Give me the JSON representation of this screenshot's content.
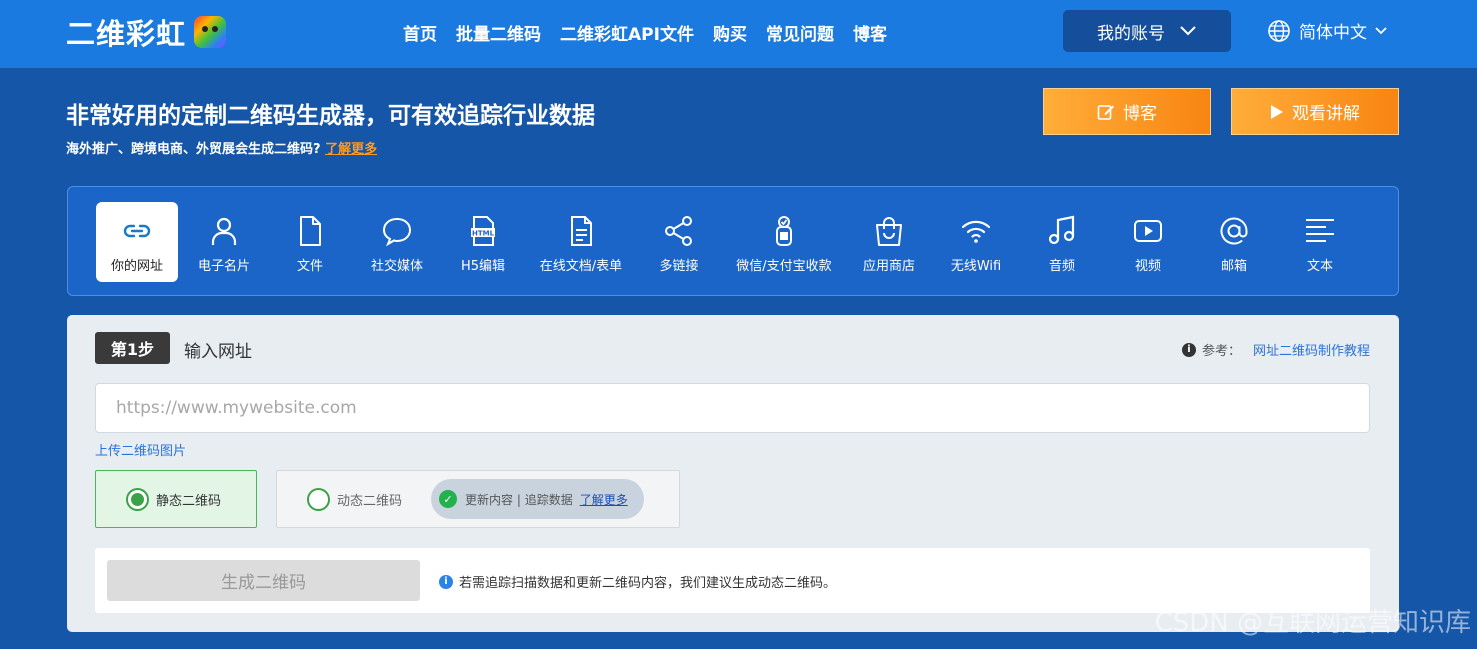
{
  "brand": {
    "name": "二维彩虹"
  },
  "nav": [
    "首页",
    "批量二维码",
    "二维彩虹API文件",
    "购买",
    "常见问题",
    "博客"
  ],
  "account": {
    "label": "我的账号"
  },
  "language": {
    "label": "简体中文"
  },
  "hero": {
    "title": "非常好用的定制二维码生成器，可有效追踪行业数据",
    "subtitle": "海外推广、跨境电商、外贸展会生成二维码?",
    "learn_more": "了解更多"
  },
  "hero_buttons": {
    "blog": "博客",
    "video": "观看讲解"
  },
  "categories": [
    {
      "label": "你的网址",
      "icon": "link-icon"
    },
    {
      "label": "电子名片",
      "icon": "person-icon"
    },
    {
      "label": "文件",
      "icon": "file-icon"
    },
    {
      "label": "社交媒体",
      "icon": "chat-bubble-icon"
    },
    {
      "label": "H5编辑",
      "icon": "html-icon"
    },
    {
      "label": "在线文档/表单",
      "icon": "document-icon"
    },
    {
      "label": "多链接",
      "icon": "share-icon"
    },
    {
      "label": "微信/支付宝收款",
      "icon": "payment-icon"
    },
    {
      "label": "应用商店",
      "icon": "shopping-bag-icon"
    },
    {
      "label": "无线Wifi",
      "icon": "wifi-icon"
    },
    {
      "label": "音频",
      "icon": "music-icon"
    },
    {
      "label": "视频",
      "icon": "video-icon"
    },
    {
      "label": "邮箱",
      "icon": "at-icon"
    },
    {
      "label": "文本",
      "icon": "text-icon"
    }
  ],
  "step": {
    "badge": "第1步",
    "title": "输入网址",
    "ref_label": "参考：",
    "ref_link": "网址二维码制作教程",
    "url_placeholder": "https://www.mywebsite.com",
    "upload_link": "上传二维码图片"
  },
  "qr_types": {
    "static": "静态二维码",
    "dynamic": "动态二维码",
    "dynamic_features": "更新内容 | 追踪数据",
    "dynamic_learn_more": "了解更多"
  },
  "generate": {
    "button": "生成二维码",
    "note": "若需追踪扫描数据和更新二维码内容，我们建议生成动态二维码。"
  },
  "watermark": "CSDN @互联网运营知识库"
}
